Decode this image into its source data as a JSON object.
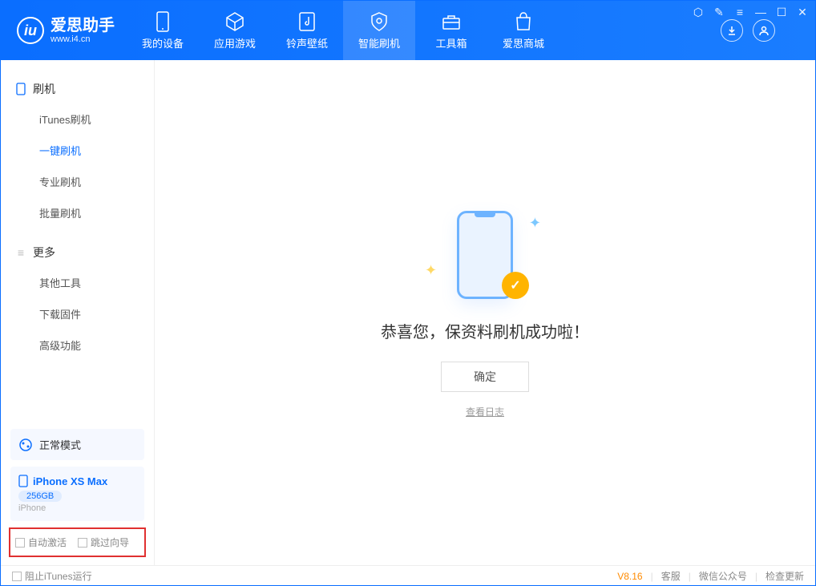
{
  "app": {
    "name": "爱思助手",
    "url": "www.i4.cn"
  },
  "nav": {
    "tabs": [
      {
        "label": "我的设备"
      },
      {
        "label": "应用游戏"
      },
      {
        "label": "铃声壁纸"
      },
      {
        "label": "智能刷机"
      },
      {
        "label": "工具箱"
      },
      {
        "label": "爱思商城"
      }
    ]
  },
  "sidebar": {
    "section1_title": "刷机",
    "items1": [
      "iTunes刷机",
      "一键刷机",
      "专业刷机",
      "批量刷机"
    ],
    "section2_title": "更多",
    "items2": [
      "其他工具",
      "下载固件",
      "高级功能"
    ],
    "mode_label": "正常模式",
    "device": {
      "name": "iPhone XS Max",
      "capacity": "256GB",
      "type": "iPhone"
    },
    "checkboxes": {
      "auto_activate": "自动激活",
      "skip_guide": "跳过向导"
    }
  },
  "main": {
    "success_text": "恭喜您，保资料刷机成功啦！",
    "confirm_label": "确定",
    "log_link": "查看日志"
  },
  "footer": {
    "block_itunes": "阻止iTunes运行",
    "version": "V8.16",
    "links": [
      "客服",
      "微信公众号",
      "检查更新"
    ]
  }
}
